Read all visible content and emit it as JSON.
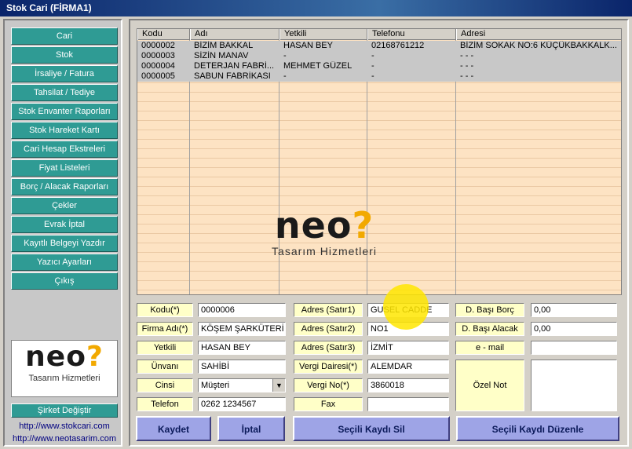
{
  "window": {
    "title": "Stok Cari (FİRMA1)"
  },
  "nav": [
    "Cari",
    "Stok",
    "İrsaliye / Fatura",
    "Tahsilat / Tediye",
    "Stok Envanter Raporları",
    "Stok Hareket Kartı",
    "Cari Hesap Ekstreleri",
    "Fiyat Listeleri",
    "Borç / Alacak Raporları",
    "Çekler",
    "Evrak İptal",
    "Kayıtlı Belgeyi Yazdır",
    "Yazıcı Ayarları",
    "Çıkış"
  ],
  "logo": {
    "word": "neo",
    "symbol": "?",
    "subtitle": "Tasarım Hizmetleri"
  },
  "company_switch": "Şirket Değiştir",
  "links": [
    "http://www.stokcari.com",
    "http://www.neotasarim.com"
  ],
  "grid": {
    "columns": [
      "Kodu",
      "Adı",
      "Yetkili",
      "Telefonu",
      "Adresi"
    ],
    "rows": [
      [
        "0000002",
        "BİZİM BAKKAL",
        "HASAN BEY",
        "02168761212",
        "BİZİM SOKAK NO:6 KÜÇÜKBAKKALK..."
      ],
      [
        "0000003",
        "SİZİN MANAV",
        "-",
        "-",
        "- - -"
      ],
      [
        "0000004",
        "DETERJAN FABRİ...",
        "MEHMET GÜZEL",
        "-",
        "- - -"
      ],
      [
        "0000005",
        "SABUN FABRİKASI",
        "-",
        "-",
        "- - -"
      ]
    ]
  },
  "form": {
    "kodu": {
      "label": "Kodu(*)",
      "value": "0000006"
    },
    "firma": {
      "label": "Firma Adı(*)",
      "value": "KÖŞEM ŞARKÜTERİ"
    },
    "yetkili": {
      "label": "Yetkili",
      "value": "HASAN BEY"
    },
    "unvani": {
      "label": "Ünvanı",
      "value": "SAHİBİ"
    },
    "cinsi": {
      "label": "Cinsi",
      "value": "Müşteri"
    },
    "telefon": {
      "label": "Telefon",
      "value": "0262 1234567"
    },
    "adres1": {
      "label": "Adres (Satır1)",
      "value": "GUSEL CADDE"
    },
    "adres2": {
      "label": "Adres (Satır2)",
      "value": "NO1"
    },
    "adres3": {
      "label": "Adres (Satır3)",
      "value": "İZMİT"
    },
    "vergi_dairesi": {
      "label": "Vergi Dairesi(*)",
      "value": "ALEMDAR"
    },
    "vergi_no": {
      "label": "Vergi No(*)",
      "value": "3860018"
    },
    "fax": {
      "label": "Fax",
      "value": ""
    },
    "dbasi_borc": {
      "label": "D. Başı Borç",
      "value": "0,00"
    },
    "dbasi_alacak": {
      "label": "D. Başı Alacak",
      "value": "0,00"
    },
    "email": {
      "label": "e - mail",
      "value": ""
    },
    "ozel_not": {
      "label": "Özel Not",
      "value": ""
    }
  },
  "actions": {
    "save": "Kaydet",
    "cancel": "İptal",
    "delete": "Seçili Kaydı Sil",
    "edit": "Seçili Kaydı Düzenle"
  },
  "colors": {
    "nav_teal": "#2f9b94",
    "grid_bg": "#fde3c3",
    "label_yellow": "#ffffc8",
    "action_blue": "#9ea4e6",
    "title_blue": "#0a246a"
  }
}
